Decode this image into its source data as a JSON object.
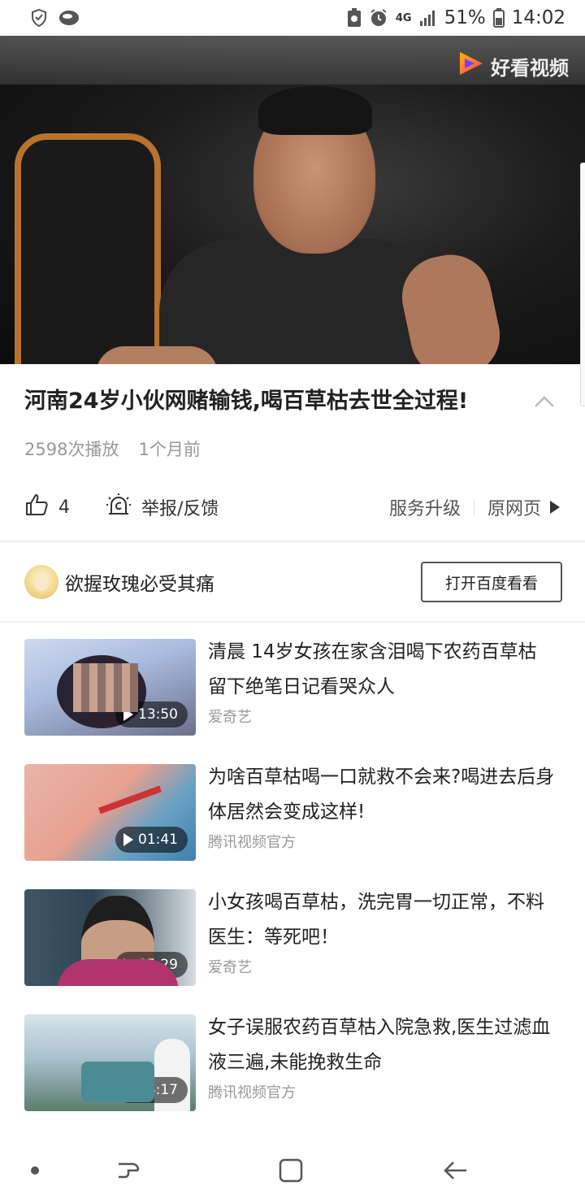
{
  "status_bar": {
    "network": "4G",
    "battery": "51%",
    "time": "14:02"
  },
  "video": {
    "watermark": "好看视频"
  },
  "title": "河南24岁小伙网赌输钱,喝百草枯去世全过程!",
  "meta": {
    "plays": "2598次播放",
    "time_ago": "1个月前"
  },
  "actions": {
    "like_count": "4",
    "report_label": "举报/反馈",
    "upgrade_label": "服务升级",
    "original_label": "原网页"
  },
  "author": {
    "name": "欲握玫瑰必受其痛",
    "open_button": "打开百度看看"
  },
  "related": [
    {
      "title": "清晨 14岁女孩在家含泪喝下农药百草枯 留下绝笔日记看哭众人",
      "source": "爱奇艺",
      "duration": "13:50"
    },
    {
      "title": "为啥百草枯喝一口就救不会来?喝进去后身体居然会变成这样!",
      "source": "腾讯视频官方",
      "duration": "01:41"
    },
    {
      "title": "小女孩喝百草枯，洗完胃一切正常，不料医生：等死吧！",
      "source": "爱奇艺",
      "duration": "05:29"
    },
    {
      "title": "女子误服农药百草枯入院急救,医生过滤血液三遍,未能挽救生命",
      "source": "腾讯视频官方",
      "duration": "04:17"
    }
  ],
  "colors": {
    "text_primary": "#222222",
    "text_secondary": "#999999",
    "divider": "#f0f0f0",
    "watermark_gradient": [
      "#ff3d6e",
      "#ffb400"
    ]
  }
}
